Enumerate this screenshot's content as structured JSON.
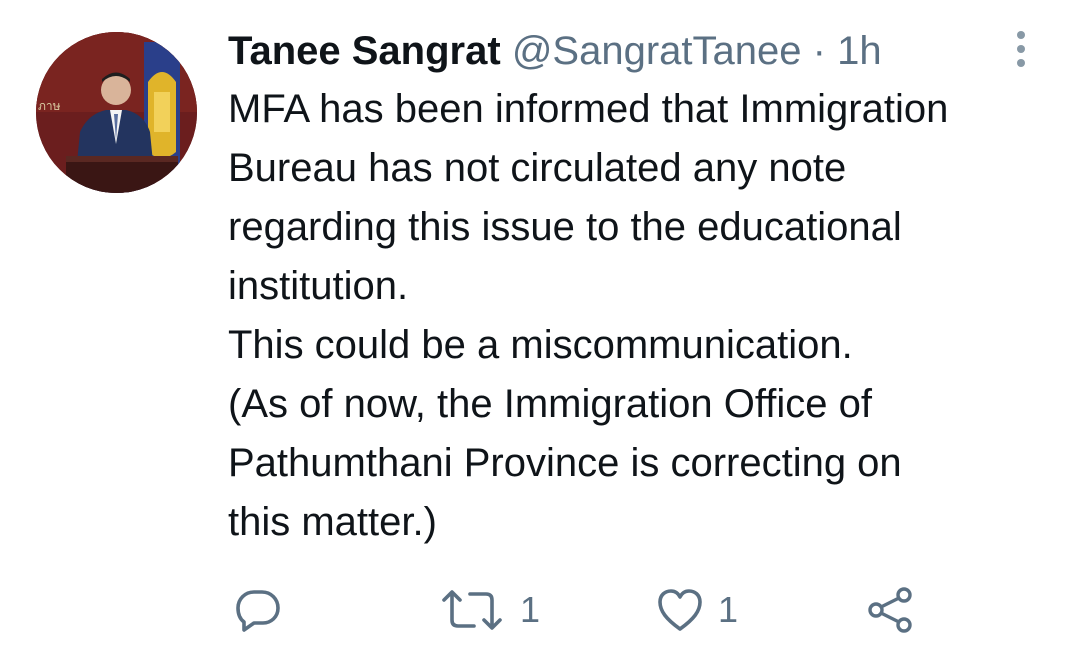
{
  "tweet": {
    "author": {
      "display_name": "Tanee Sangrat",
      "handle": "@SangratTanee",
      "separator": "·",
      "time": "1h"
    },
    "text_lines": [
      "MFA has been informed that Immigration",
      "Bureau has not circulated any note",
      "regarding this issue to the educational",
      "institution.",
      "This could be a miscommunication.",
      "(As of now, the Immigration Office of",
      "Pathumthani Province is correcting on",
      "this matter.)"
    ],
    "avatar_sign_text": "ภาษ",
    "actions": {
      "reply": {
        "icon": "reply-icon",
        "count": ""
      },
      "retweet": {
        "icon": "retweet-icon",
        "count": "1"
      },
      "like": {
        "icon": "heart-icon",
        "count": "1"
      },
      "share": {
        "icon": "share-icon",
        "count": ""
      }
    },
    "colors": {
      "text": "#0f1419",
      "secondary": "#5b7083",
      "icon": "#5b7083"
    }
  }
}
